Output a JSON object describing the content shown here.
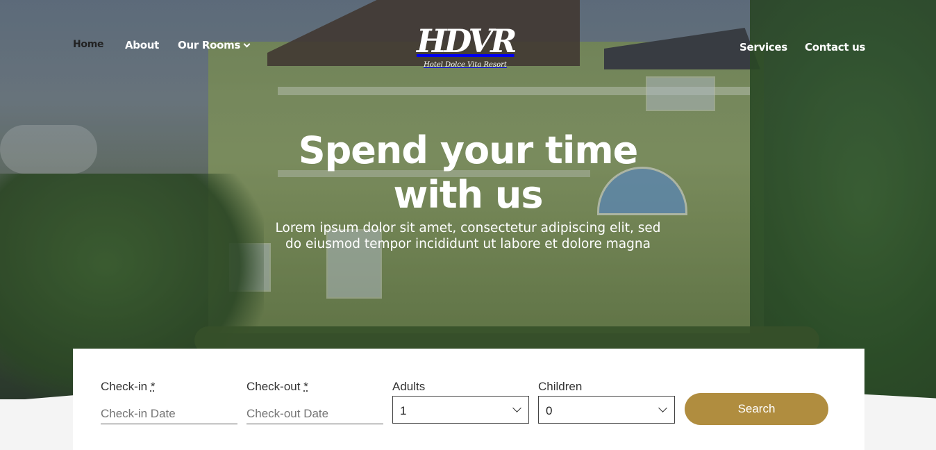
{
  "nav": {
    "home": "Home",
    "about": "About",
    "rooms": "Our Rooms",
    "services": "Services",
    "contact": "Contact us"
  },
  "logo": {
    "mark": "HDVR",
    "text": "Hotel Dolce Vita Resort"
  },
  "hero": {
    "title": "Spend your time with us",
    "subtitle": "Lorem ipsum dolor sit amet, consectetur adipiscing elit, sed do eiusmod tempor incididunt ut labore et dolore magna"
  },
  "booking": {
    "checkin_label": "Check-in",
    "checkin_required": "*",
    "checkin_placeholder": "Check-in Date",
    "checkout_label": "Check-out",
    "checkout_required": "*",
    "checkout_placeholder": "Check-out Date",
    "adults_label": "Adults",
    "adults_value": "1",
    "children_label": "Children",
    "children_value": "0",
    "search_label": "Search"
  },
  "colors": {
    "accent": "#b08d3f"
  }
}
